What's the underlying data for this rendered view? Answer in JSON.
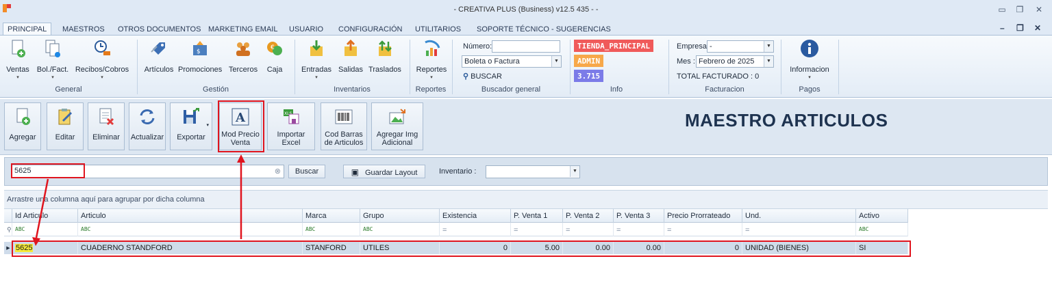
{
  "window": {
    "title": "- CREATIVA PLUS (Business) v12.5 435 - -"
  },
  "tabs": [
    "PRINCIPAL",
    "MAESTROS",
    "OTROS DOCUMENTOS",
    "MARKETING EMAIL",
    "USUARIO",
    "CONFIGURACIÓN",
    "UTILITARIOS",
    "SOPORTE TÉCNICO - SUGERENCIAS"
  ],
  "ribbon": {
    "general": {
      "label": "General",
      "items": [
        "Ventas",
        "Bol./Fact.",
        "Recibos/Cobros"
      ]
    },
    "gestion": {
      "label": "Gestión",
      "items": [
        "Artículos",
        "Promociones",
        "Terceros",
        "Caja"
      ]
    },
    "inventarios": {
      "label": "Inventarios",
      "items": [
        "Entradas",
        "Salidas",
        "Traslados"
      ]
    },
    "reportes": {
      "label": "Reportes",
      "items": [
        "Reportes"
      ]
    },
    "buscador": {
      "label": "Buscador general",
      "numero_label": "Número:",
      "numero_value": "",
      "doc_type": "Boleta o Factura",
      "buscar": "BUSCAR"
    },
    "info": {
      "label": "Info",
      "tienda": "TIENDA_PRINCIPAL",
      "user": "ADMIN",
      "value": "3.715"
    },
    "facturacion": {
      "label": "Facturacion",
      "empresa_label": "Empresa",
      "empresa_value": "-",
      "mes_label": "Mes :",
      "mes_value": "Febrero de 2025",
      "total": "TOTAL FACTURADO : 0"
    },
    "pagos": {
      "label": "Pagos",
      "items": [
        "Informacion"
      ]
    }
  },
  "toolbar": {
    "agregar": "Agregar",
    "editar": "Editar",
    "eliminar": "Eliminar",
    "actualizar": "Actualizar",
    "exportar": "Exportar",
    "mod_precio_1": "Mod Precio",
    "mod_precio_2": "Venta",
    "importar_1": "Importar",
    "importar_2": "Excel",
    "cod_barras_1": "Cod Barras",
    "cod_barras_2": "de Articulos",
    "agregar_img_1": "Agregar Img",
    "agregar_img_2": "Adicional"
  },
  "panel_title": "MAESTRO ARTICULOS",
  "search": {
    "value": "5625",
    "buscar": "Buscar",
    "guardar_layout": "Guardar Layout",
    "inventario_label": "Inventario :",
    "inventario_value": ""
  },
  "grid": {
    "group_hint": "Arrastre una columna aquí para agrupar por dicha columna",
    "columns": [
      "Id Articulo",
      "Articulo",
      "Marca",
      "Grupo",
      "Existencia",
      "P. Venta 1",
      "P. Venta 2",
      "P. Venta 3",
      "Precio Prorrateado",
      "Und.",
      "Activo"
    ],
    "rows": [
      [
        "5625",
        "CUADERNO STANDFORD",
        "STANFORD",
        "UTILES",
        "0",
        "5.00",
        "0.00",
        "0.00",
        "0",
        "UNIDAD (BIENES)",
        "SI"
      ]
    ]
  },
  "colors": {
    "accent_red": "#e0141e",
    "badge_tienda": "#f05a5a",
    "badge_admin": "#f7a84a",
    "badge_value": "#7b7be8"
  }
}
